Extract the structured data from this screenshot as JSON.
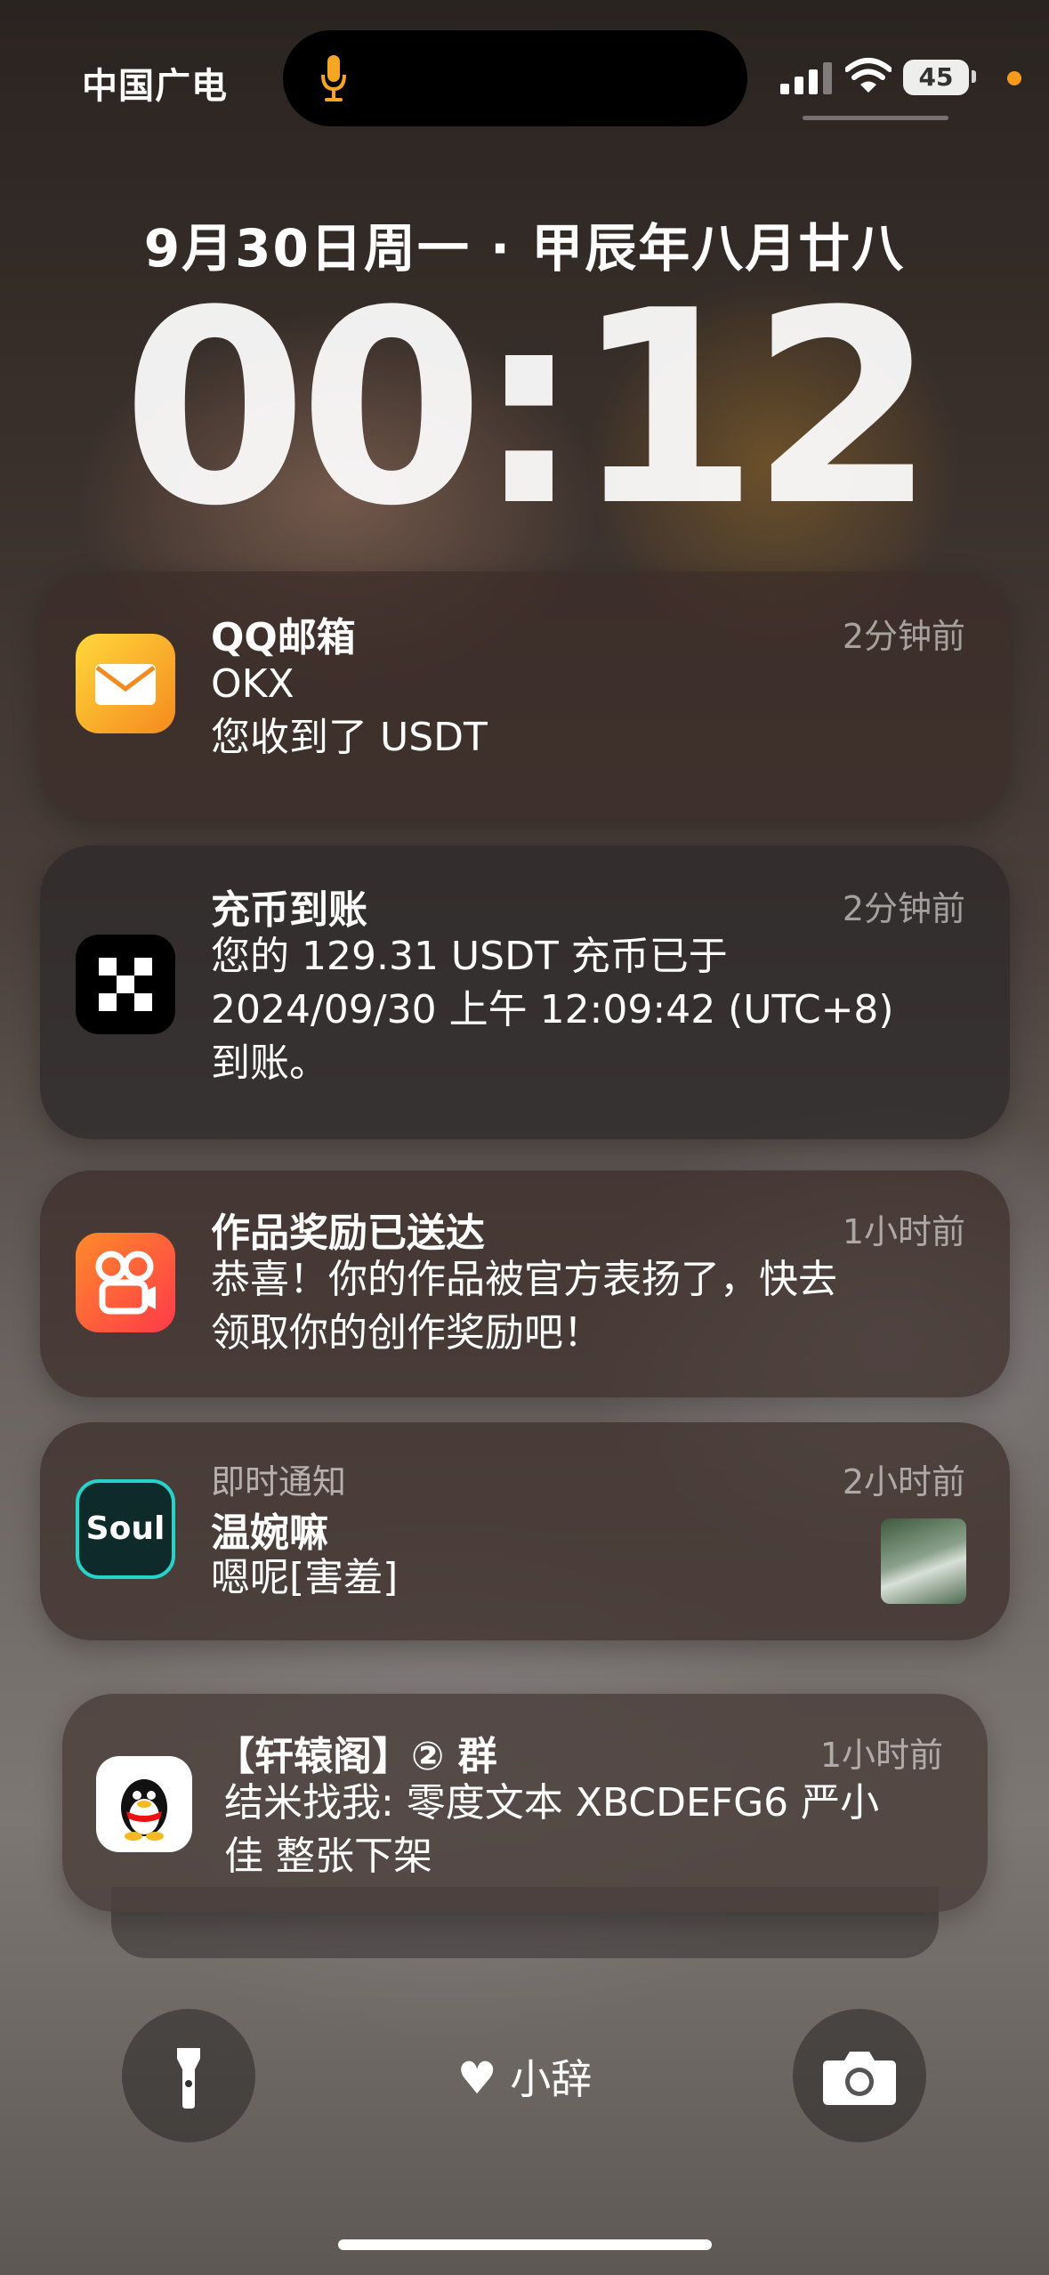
{
  "status": {
    "carrier": "中国广电",
    "battery": "45"
  },
  "lock": {
    "date": "9月30日周一 · 甲辰年八月廿八",
    "time": "00:12"
  },
  "notifications": [
    {
      "app": "QQ邮箱",
      "time": "2分钟前",
      "line1": "OKX",
      "line2": "您收到了 USDT"
    },
    {
      "app": "充币到账",
      "time": "2分钟前",
      "line1": "您的 129.31 USDT 充币已于",
      "line2": "2024/09/30 上午 12:09:42 (UTC+8)",
      "line3": "到账。"
    },
    {
      "app": "作品奖励已送达",
      "time": "1小时前",
      "line1": "恭喜！你的作品被官方表扬了，快去",
      "line2": "领取你的创作奖励吧！"
    },
    {
      "category": "即时通知",
      "time": "2小时前",
      "app": "温婉嘛",
      "line1": "嗯呢[害羞]"
    },
    {
      "app": "【轩辕阁】② 群",
      "time": "1小时前",
      "line1": "结米找我: 零度文本 XBCDEFG6 严小",
      "line2": "佳 整张下架"
    }
  ],
  "bottom": {
    "center_label": "小辞"
  }
}
